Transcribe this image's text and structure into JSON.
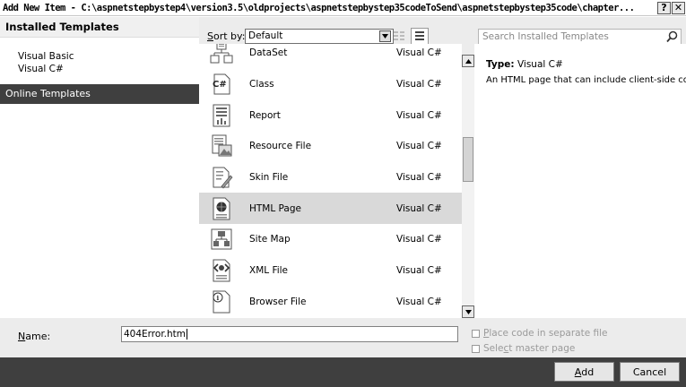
{
  "window": {
    "title": "Add New Item - C:\\aspnetstepbystep4\\version3.5\\oldprojects\\aspnetstepbystep35codeToSend\\aspnetstepbystep35code\\chapter...",
    "help_button": "?",
    "close_button": "✕"
  },
  "left_pane": {
    "header": "Installed Templates",
    "tree": [
      "Visual Basic",
      "Visual C#"
    ],
    "online": "Online Templates"
  },
  "toolbar": {
    "sort_label": "Sort by:",
    "sort_value": "Default",
    "search_placeholder": "Search Installed Templates"
  },
  "templates": [
    {
      "name": "DataSet",
      "lang": "Visual C#",
      "icon": "dataset-icon",
      "selected": false
    },
    {
      "name": "Class",
      "lang": "Visual C#",
      "icon": "class-icon",
      "selected": false
    },
    {
      "name": "Report",
      "lang": "Visual C#",
      "icon": "report-icon",
      "selected": false
    },
    {
      "name": "Resource File",
      "lang": "Visual C#",
      "icon": "resource-file-icon",
      "selected": false
    },
    {
      "name": "Skin File",
      "lang": "Visual C#",
      "icon": "skin-file-icon",
      "selected": false
    },
    {
      "name": "HTML Page",
      "lang": "Visual C#",
      "icon": "html-page-icon",
      "selected": true
    },
    {
      "name": "Site Map",
      "lang": "Visual C#",
      "icon": "site-map-icon",
      "selected": false
    },
    {
      "name": "XML File",
      "lang": "Visual C#",
      "icon": "xml-file-icon",
      "selected": false
    },
    {
      "name": "Browser File",
      "lang": "Visual C#",
      "icon": "browser-file-icon",
      "selected": false
    }
  ],
  "info": {
    "type_label": "Type:",
    "type_value": "Visual C#",
    "description": "An HTML page that can include client-side code"
  },
  "form": {
    "name_label": "Name:",
    "name_value": "404Error.htm",
    "checkbox_separate": "Place code in separate file",
    "checkbox_master": "Select master page"
  },
  "buttons": {
    "add": "Add",
    "cancel": "Cancel"
  }
}
